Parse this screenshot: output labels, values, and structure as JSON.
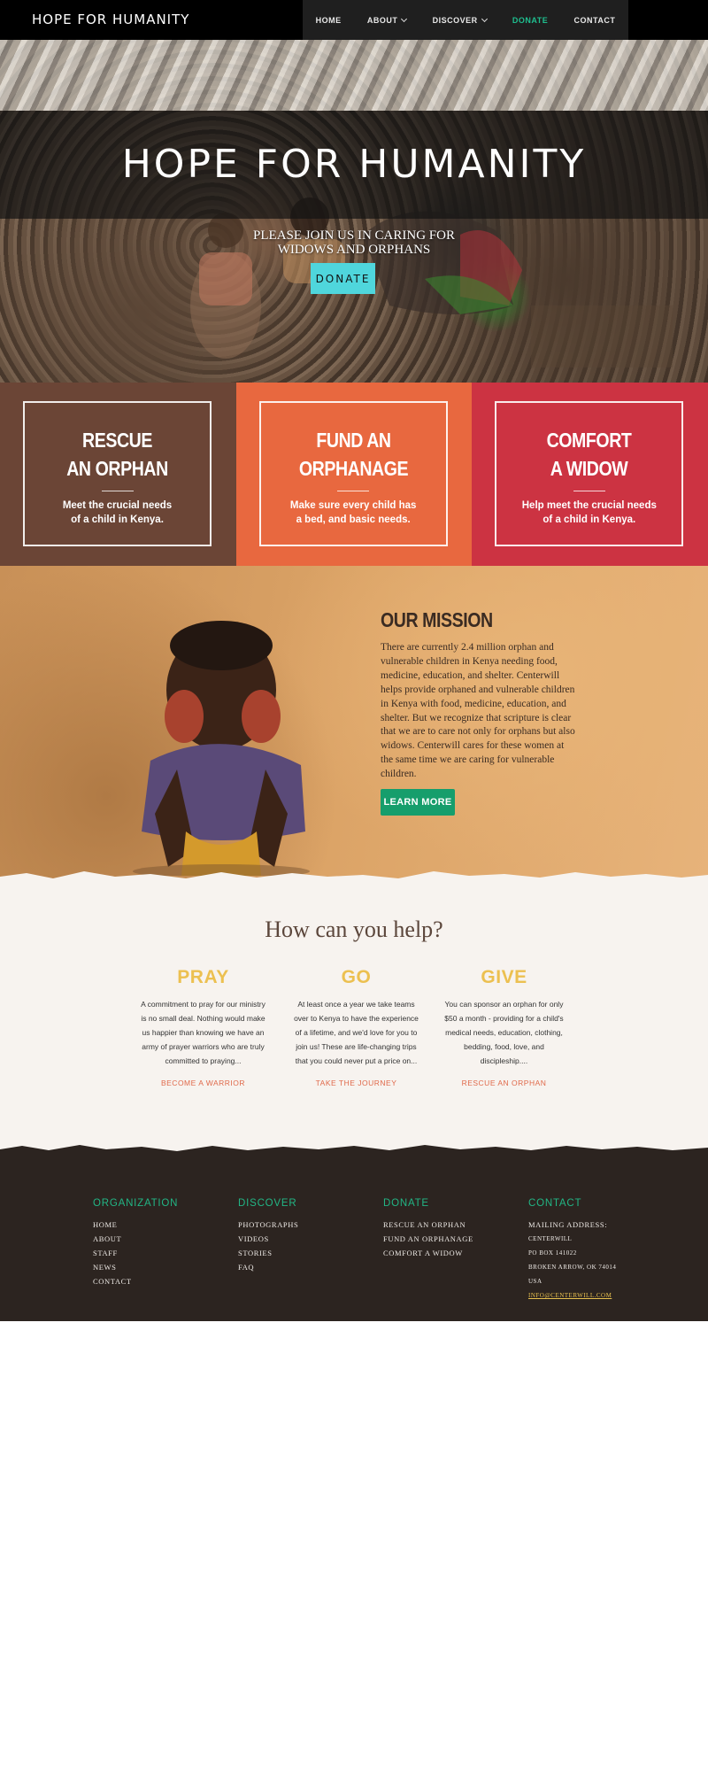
{
  "nav": {
    "brand": "HOPE FOR HUMANITY",
    "items": [
      {
        "label": "HOME"
      },
      {
        "label": "ABOUT"
      },
      {
        "label": "DISCOVER"
      },
      {
        "label": "DONATE"
      },
      {
        "label": "CONTACT"
      }
    ]
  },
  "hero": {
    "title": "HOPE FOR HUMANITY",
    "subtitle_line1": "PLEASE JOIN US IN CARING FOR",
    "subtitle_line2": "WIDOWS AND ORPHANS",
    "button": "DONATE"
  },
  "cards": [
    {
      "title": "RESCUE\nAN ORPHAN",
      "text": "Meet the crucial needs\nof a child in Kenya.",
      "color": "#6b4536"
    },
    {
      "title": "FUND AN\nORPHANAGE",
      "text": "Make sure every child has\na bed, and basic needs.",
      "color": "#e8683f"
    },
    {
      "title": "COMFORT\nA WIDOW",
      "text": "Help meet the crucial needs\nof a child in Kenya.",
      "color": "#cc3342"
    }
  ],
  "mission": {
    "title": "OUR MISSION",
    "text": "There are currently 2.4 million orphan and vulnerable children in Kenya needing food, medicine, education, and shelter. Centerwill helps provide orphaned and vulnerable children in Kenya with food, medicine, education, and shelter. But we recognize that scripture is clear that we are to care not only for orphans but also widows. Centerwill cares for these women at the same time we are caring for vulnerable children.",
    "button": "LEARN MORE"
  },
  "help": {
    "title": "How can you help?",
    "columns": [
      {
        "heading": "PRAY",
        "text": "A commitment to pray for our ministry is no small deal. Nothing would make us happier than knowing we have an army of prayer warriors who are truly committed to praying...",
        "link": "BECOME A WARRIOR"
      },
      {
        "heading": "GO",
        "text": "At least once a year we take teams over to Kenya to have the experience of a lifetime, and we'd love for you to join us! These are life-changing trips that you could never put a price on...",
        "link": "TAKE THE JOURNEY"
      },
      {
        "heading": "GIVE",
        "text": "You can sponsor an orphan for only $50 a month - providing for a child's medical needs, education, clothing, bedding, food, love, and discipleship....",
        "link": "RESCUE AN ORPHAN"
      }
    ]
  },
  "footer": {
    "organization": {
      "heading": "ORGANIZATION",
      "links": [
        "HOME",
        "ABOUT",
        "STAFF",
        "NEWS",
        "CONTACT"
      ]
    },
    "discover": {
      "heading": "DISCOVER",
      "links": [
        "PHOTOGRAPHS",
        "VIDEOS",
        "STORIES",
        "FAQ"
      ]
    },
    "donate": {
      "heading": "DONATE",
      "links": [
        "RESCUE AN ORPHAN",
        "FUND AN ORPHANAGE",
        "COMFORT A WIDOW"
      ]
    },
    "contact": {
      "heading": "CONTACT",
      "mailing_label": "MAILING ADDRESS:",
      "lines": [
        "CENTERWILL",
        "PO BOX 141022",
        "BROKEN ARROW, OK 74014",
        "USA"
      ],
      "email": "INFO@CENTERWILL.COM"
    }
  }
}
